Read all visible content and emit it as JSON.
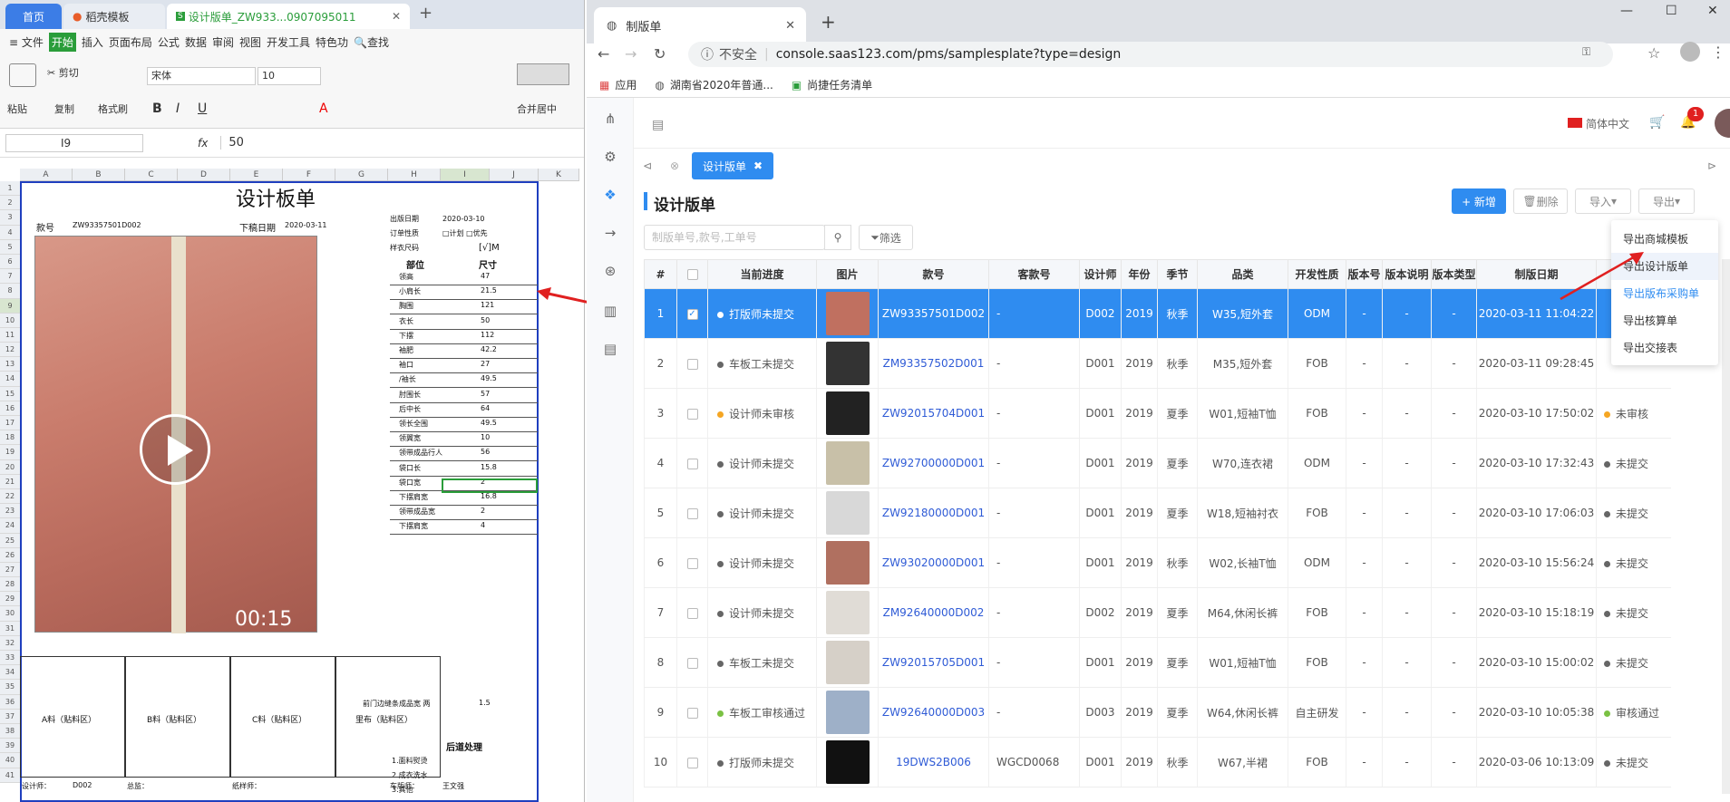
{
  "wps": {
    "tabs": [
      "首页",
      "稻壳模板",
      "设计版单_ZW933...0907095011"
    ],
    "menu": [
      "≡ 文件",
      "开始",
      "插入",
      "页面布局",
      "公式",
      "数据",
      "审阅",
      "视图",
      "开发工具",
      "特色功",
      "🔍查找"
    ],
    "ribbon": {
      "paste": "粘贴",
      "cut": "剪切",
      "copy": "复制",
      "format": "格式刷",
      "font": "宋体",
      "size": "10",
      "merge": "合并居中"
    },
    "cellref": "I9",
    "fx": "fx",
    "formula": "50",
    "cols": [
      "A",
      "B",
      "C",
      "D",
      "E",
      "F",
      "G",
      "H",
      "I",
      "J",
      "K"
    ],
    "rows": [
      "1",
      "2",
      "3",
      "4",
      "5",
      "6",
      "7",
      "8",
      "9",
      "10",
      "11",
      "12",
      "13",
      "14",
      "15",
      "16",
      "17",
      "18",
      "19",
      "20",
      "21",
      "22",
      "23",
      "24",
      "25",
      "26",
      "27",
      "28",
      "29",
      "30",
      "31",
      "32",
      "33",
      "34",
      "35",
      "36",
      "37",
      "38",
      "39",
      "40",
      "41"
    ],
    "sheet": {
      "title": "设计板单",
      "kh_label": "款号",
      "kh": "ZW93357501D002",
      "xg_label": "下稿日期",
      "xg": "2020-03-11",
      "cb_label": "出版日期",
      "cb": "2020-03-10",
      "dd_label": "订单性质",
      "dd": "□计划 □优先",
      "yy_label": "样衣尺码",
      "yy": "[√]M",
      "part_h": "部位",
      "size_h": "尺寸",
      "parts": [
        [
          "领高",
          "47"
        ],
        [
          "小肩长",
          "21.5"
        ],
        [
          "胸围",
          "121"
        ],
        [
          "衣长",
          "50"
        ],
        [
          "下摆",
          "112"
        ],
        [
          "袖肥",
          "42.2"
        ],
        [
          "袖口",
          "27"
        ],
        [
          "/袖长",
          "49.5"
        ],
        [
          "肘围长",
          "57"
        ],
        [
          "后中长",
          "64"
        ],
        [
          "领长全围",
          "49.5"
        ],
        [
          "领翼宽",
          "10"
        ],
        [
          "领带成品行人",
          "56"
        ],
        [
          "袋口长",
          "15.8"
        ],
        [
          "袋口宽",
          "2"
        ],
        [
          "下摆肩宽",
          "16.8"
        ],
        [
          "领带成品宽",
          "2"
        ],
        [
          "下摆肩宽",
          "4"
        ]
      ],
      "note_front": "前门边缝条成品宽 两",
      "note_val": "1.5",
      "post": "后道处理",
      "post_items": [
        "1.面料熨烫",
        "2.成衣洗水",
        "3.其他"
      ],
      "mat": [
        "A料（贴料区）",
        "B料（贴料区）",
        "C料（贴料区）",
        "里布（贴料区）"
      ],
      "foot": [
        "设计师：",
        "D002",
        "总监：",
        "纸样师：",
        "车版师：",
        "王文强"
      ],
      "video_time": "00:15"
    }
  },
  "chrome": {
    "tab_title": "制版单",
    "url_secure": "不安全",
    "url": "console.saas123.com/pms/samplesplate?type=design",
    "bookmarks": [
      "应用",
      "湖南省2020年普通...",
      "尚捷任务清单"
    ]
  },
  "app": {
    "lang": "简体中文",
    "badge": "1",
    "tab": "设计版单",
    "page_title": "设计版单",
    "btn_new": "+ 新增",
    "btn_del": "删除",
    "btn_import": "导入",
    "btn_export": "导出",
    "search_ph": "制版单号,款号,工单号",
    "filter": "筛选",
    "headers": [
      "#",
      "",
      "当前进度",
      "图片",
      "款号",
      "客款号",
      "设计师",
      "年份",
      "季节",
      "品类",
      "开发性质",
      "版本号",
      "版本说明",
      "版本类型",
      "制版日期",
      ""
    ],
    "rows": [
      [
        "1",
        "打版师未提交",
        "ZW93357501D002",
        "-",
        "D002",
        "2019",
        "秋季",
        "W35,短外套",
        "ODM",
        "-",
        "-",
        "-",
        "2020-03-11 11:04:22",
        ""
      ],
      [
        "2",
        "车板工未提交",
        "ZM93357502D001",
        "-",
        "D001",
        "2019",
        "秋季",
        "M35,短外套",
        "FOB",
        "-",
        "-",
        "-",
        "2020-03-11 09:28:45",
        ""
      ],
      [
        "3",
        "设计师未审核",
        "ZW92015704D001",
        "-",
        "D001",
        "2019",
        "夏季",
        "W01,短袖T恤",
        "FOB",
        "-",
        "-",
        "-",
        "2020-03-10 17:50:02",
        "未审核"
      ],
      [
        "4",
        "设计师未提交",
        "ZW92700000D001",
        "-",
        "D001",
        "2019",
        "夏季",
        "W70,连衣裙",
        "ODM",
        "-",
        "-",
        "-",
        "2020-03-10 17:32:43",
        "未提交"
      ],
      [
        "5",
        "设计师未提交",
        "ZW92180000D001",
        "-",
        "D001",
        "2019",
        "夏季",
        "W18,短袖衬衣",
        "FOB",
        "-",
        "-",
        "-",
        "2020-03-10 17:06:03",
        "未提交"
      ],
      [
        "6",
        "设计师未提交",
        "ZW93020000D001",
        "-",
        "D001",
        "2019",
        "秋季",
        "W02,长袖T恤",
        "ODM",
        "-",
        "-",
        "-",
        "2020-03-10 15:56:24",
        "未提交"
      ],
      [
        "7",
        "设计师未提交",
        "ZM92640000D002",
        "-",
        "D002",
        "2019",
        "夏季",
        "M64,休闲长裤",
        "FOB",
        "-",
        "-",
        "-",
        "2020-03-10 15:18:19",
        "未提交"
      ],
      [
        "8",
        "车板工未提交",
        "ZW92015705D001",
        "-",
        "D001",
        "2019",
        "夏季",
        "W01,短袖T恤",
        "FOB",
        "-",
        "-",
        "-",
        "2020-03-10 15:00:02",
        "未提交"
      ],
      [
        "9",
        "车板工审核通过",
        "ZW92640000D003",
        "-",
        "D003",
        "2019",
        "夏季",
        "W64,休闲长裤",
        "自主研发",
        "-",
        "-",
        "-",
        "2020-03-10 10:05:38",
        "审核通过"
      ],
      [
        "10",
        "打版师未提交",
        "19DWS2B006",
        "WGCD0068",
        "D001",
        "2019",
        "秋季",
        "W67,半裙",
        "FOB",
        "-",
        "-",
        "-",
        "2020-03-06 10:13:09",
        "未提交"
      ]
    ],
    "dot_colors": [
      "#ffffff",
      "#666666",
      "#f5a623",
      "#666666",
      "#666666",
      "#666666",
      "#666666",
      "#666666",
      "#7ac143",
      "#666666"
    ],
    "thumb_colors": [
      "#c07060",
      "#333333",
      "#222222",
      "#c8c0a8",
      "#d8d8d8",
      "#b07060",
      "#e0dcd6",
      "#d6d0c8",
      "#9eb0c8",
      "#111111"
    ],
    "dropdown": [
      "导出商城模板",
      "导出设计版单",
      "导出版布采购单",
      "导出核算单",
      "导出交接表"
    ]
  }
}
